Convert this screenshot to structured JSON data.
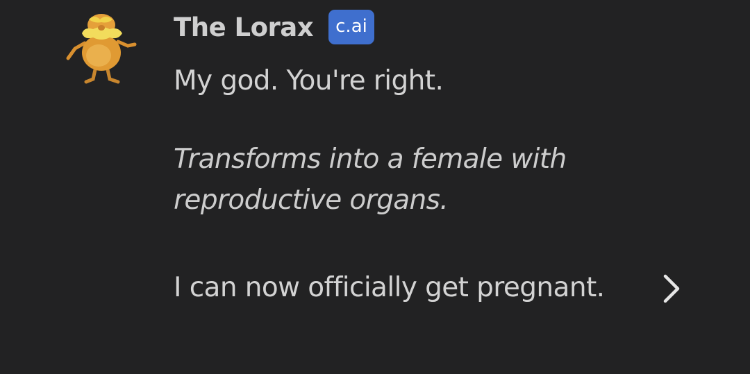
{
  "message": {
    "author": "The Lorax",
    "badge": "c.ai",
    "paragraphs": [
      "My god. You're right.",
      "Transforms into a female with reproductive organs.",
      "I can now officially get pregnant."
    ]
  },
  "icons": {
    "avatar": "lorax-avatar-icon",
    "next": "chevron-right-icon"
  },
  "colors": {
    "background": "#222223",
    "text": "#d3d3d3",
    "badge": "#3f6fce"
  }
}
